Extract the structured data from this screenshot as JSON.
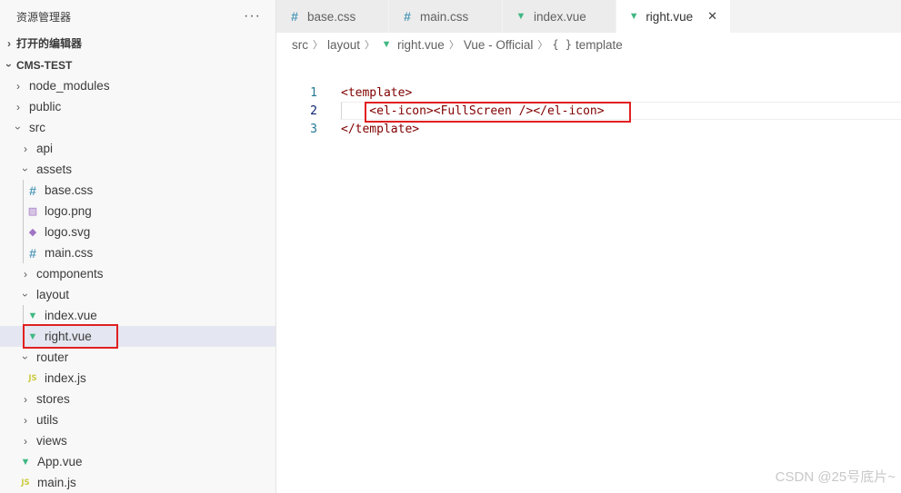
{
  "explorer": {
    "title": "资源管理器",
    "more": "···",
    "open_editors_label": "打开的编辑器",
    "workspace_label": "CMS-TEST",
    "items": [
      {
        "label": "node_modules",
        "kind": "folder",
        "expanded": false
      },
      {
        "label": "public",
        "kind": "folder",
        "expanded": false
      },
      {
        "label": "src",
        "kind": "folder",
        "expanded": true
      },
      {
        "label": "api",
        "kind": "folder",
        "expanded": false
      },
      {
        "label": "assets",
        "kind": "folder",
        "expanded": true
      },
      {
        "label": "base.css",
        "kind": "css-file"
      },
      {
        "label": "logo.png",
        "kind": "image-file"
      },
      {
        "label": "logo.svg",
        "kind": "svg-file"
      },
      {
        "label": "main.css",
        "kind": "css-file"
      },
      {
        "label": "components",
        "kind": "folder",
        "expanded": false
      },
      {
        "label": "layout",
        "kind": "folder",
        "expanded": true
      },
      {
        "label": "index.vue",
        "kind": "vue-file"
      },
      {
        "label": "right.vue",
        "kind": "vue-file",
        "selected": true
      },
      {
        "label": "router",
        "kind": "folder",
        "expanded": true
      },
      {
        "label": "index.js",
        "kind": "js-file"
      },
      {
        "label": "stores",
        "kind": "folder",
        "expanded": false
      },
      {
        "label": "utils",
        "kind": "folder",
        "expanded": false
      },
      {
        "label": "views",
        "kind": "folder",
        "expanded": false
      },
      {
        "label": "App.vue",
        "kind": "vue-file"
      },
      {
        "label": "main.js",
        "kind": "js-file"
      }
    ]
  },
  "tabs": [
    {
      "label": "base.css",
      "icon": "css-icon"
    },
    {
      "label": "main.css",
      "icon": "css-icon"
    },
    {
      "label": "index.vue",
      "icon": "vue-icon"
    },
    {
      "label": "right.vue",
      "icon": "vue-icon",
      "active": true,
      "close": "✕"
    }
  ],
  "breadcrumb": {
    "src": "src",
    "layout": "layout",
    "file": "right.vue",
    "lang": "Vue - Official",
    "symbol_icon": "{ }",
    "symbol": "template"
  },
  "code": [
    {
      "num": "1",
      "text": "<template>"
    },
    {
      "num": "2",
      "text": "    <el-icon><FullScreen /></el-icon>"
    },
    {
      "num": "3",
      "text": "</template>"
    }
  ],
  "watermark": "CSDN @25号底片~",
  "colors": {
    "highlight_box": "#e02020",
    "vue": "#41b883",
    "css": "#519aba",
    "js": "#cbcb41"
  }
}
